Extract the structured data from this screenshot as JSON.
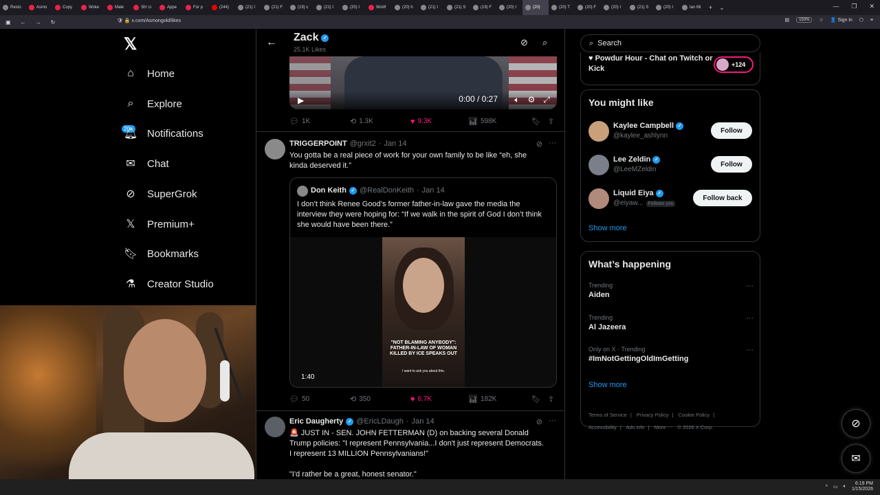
{
  "browser": {
    "tabs": [
      "Resto",
      "Asmo",
      "Copy",
      "Woke",
      "Male",
      "Sh! ci",
      "Appe",
      "For p",
      "(244)",
      "(21) I",
      "(21) F",
      "(19) c",
      "(21) I",
      "(20) I",
      "WoW",
      "(20) h",
      "(21) I",
      "(21) S",
      "(19) F",
      "(20) I",
      "(20)",
      "(20) T",
      "(20) F",
      "(20) I",
      "(21) S",
      "(20) I",
      "Ian Mi"
    ],
    "active_tab_index": 20,
    "url": "x.com/Asmongold/likes",
    "zoom": "150%",
    "sign_in": "Sign in"
  },
  "nav": {
    "items": [
      {
        "label": "Home",
        "icon": "home-icon"
      },
      {
        "label": "Explore",
        "icon": "search-icon"
      },
      {
        "label": "Notifications",
        "icon": "bell-icon"
      },
      {
        "label": "Chat",
        "icon": "mail-icon"
      },
      {
        "label": "SuperGrok",
        "icon": "grok-icon"
      },
      {
        "label": "Premium+",
        "icon": "x-icon"
      },
      {
        "label": "Bookmarks",
        "icon": "bookmark-icon"
      },
      {
        "label": "Creator Studio",
        "icon": "flask-icon"
      }
    ],
    "notifications_badge": "20+"
  },
  "header": {
    "name": "Zack",
    "subtitle": "25.1K Likes"
  },
  "post1": {
    "video_time": "0:00 / 0:27",
    "replies": "1K",
    "reposts": "1.3K",
    "likes": "9.3K",
    "views": "598K"
  },
  "post2": {
    "name": "TRIGGERPOINT",
    "handle": "@grxit2",
    "date": "Jan 14",
    "text": "You gotta be a real piece of work for your own family to be like “eh, she kinda deserved it.”",
    "quote": {
      "name": "Don Keith",
      "handle": "@RealDonKeith",
      "date": "Jan 14",
      "text": "I don’t think Renee Good’s former father-in-law gave the media the interview they were hoping for: “If we walk in the spirit of God I don’t think she would have been there.”",
      "video_caption": "\"NOT BLAMING ANYBODY\": FATHER-IN-LAW OF WOMAN KILLED BY ICE SPEAKS OUT",
      "video_subcaption": "I want to ask you about this.",
      "duration": "1:40"
    },
    "replies": "50",
    "reposts": "350",
    "likes": "6.7K",
    "views": "182K"
  },
  "post3": {
    "name": "Eric Daugherty",
    "handle": "@EricLDaugh",
    "date": "Jan 14",
    "text": "🚨 JUST IN - SEN. JOHN FETTERMAN (D) on backing several Donald Trump policies: \"I represent Pennsylvania...I don't just represent Democrats. I represent 13 MILLION Pennsylvanians!\"",
    "text2": "\"I'd rather be a great, honest senator.\""
  },
  "right": {
    "search_placeholder": "Search",
    "live_text": "Powdur Hour - Chat on Twitch or Kick",
    "live_count": "+124",
    "might_like_title": "You might like",
    "suggestions": [
      {
        "name": "Kaylee Campbell",
        "handle": "@kaylee_ashlynn",
        "button": "Follow"
      },
      {
        "name": "Lee Zeldin",
        "handle": "@LeeMZeldin",
        "button": "Follow"
      },
      {
        "name": "Liquid Eiya",
        "handle": "@eiyaw...",
        "follows_you": "Follows you",
        "button": "Follow back"
      }
    ],
    "show_more": "Show more",
    "happening_title": "What’s happening",
    "trends": [
      {
        "context": "Trending",
        "title": "Aiden"
      },
      {
        "context": "Trending",
        "title": "Al Jazeera"
      },
      {
        "context": "Only on X · Trending",
        "title": "#ImNotGettingOldImGetting"
      }
    ],
    "footer": [
      "Terms of Service",
      "|",
      "Privacy Policy",
      "|",
      "Cookie Policy",
      "|",
      "Accessibility",
      "|",
      "Ads info",
      "|",
      "More ···",
      "© 2026 X Corp."
    ]
  },
  "taskbar": {
    "time": "6:19 PM",
    "date": "1/15/2026"
  },
  "colors": {
    "accent": "#1d9bf0",
    "like": "#f91880",
    "background": "#000000",
    "muted": "#71767b"
  }
}
